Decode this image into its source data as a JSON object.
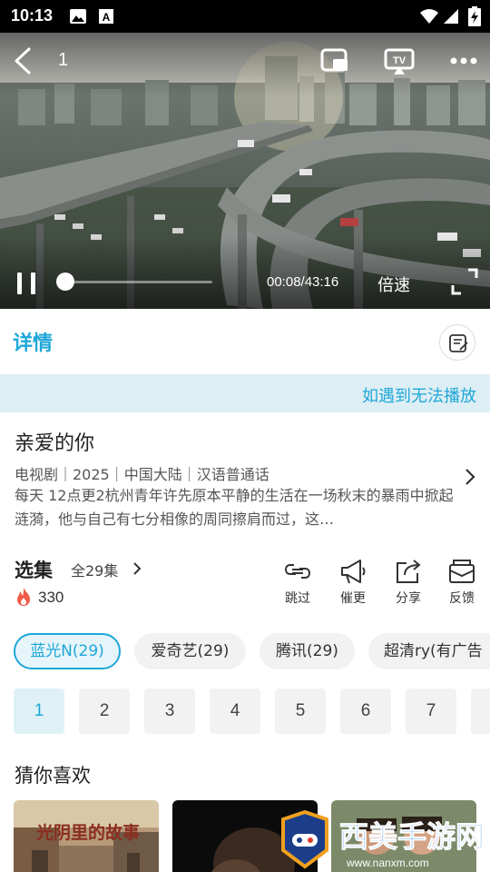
{
  "status_bar": {
    "time": "10:13",
    "icons": [
      "gallery-icon",
      "a-notification-icon",
      "wifi-icon",
      "signal-icon",
      "battery-icon"
    ]
  },
  "player": {
    "episode_label": "1",
    "current_time_total": "00:08/43:16",
    "speed_label": "倍速",
    "progress_fraction": 0.003,
    "icons": [
      "back-icon",
      "pip-icon",
      "tv-cast-icon",
      "more-icon",
      "pause-icon",
      "fullscreen-icon"
    ]
  },
  "detail_tab": {
    "title": "详情",
    "note_icon": "note-icon"
  },
  "notice": {
    "text": "如遇到无法播放"
  },
  "show": {
    "title": "亲爱的你",
    "meta": "电视剧｜2025｜中国大陆｜汉语普通话",
    "description": "每天 12点更2杭州青年许先原本平静的生活在一场秋末的暴雨中掀起涟漪，他与自己有七分相像的周同擦肩而过，这…"
  },
  "episodes": {
    "title": "选集",
    "count": "全29集",
    "hot_count": "330",
    "actions": [
      {
        "label": "跳过",
        "icon": "skip-icon"
      },
      {
        "label": "催更",
        "icon": "megaphone-icon"
      },
      {
        "label": "分享",
        "icon": "share-icon"
      },
      {
        "label": "反馈",
        "icon": "feedback-icon"
      }
    ],
    "sources": [
      "蓝光N(29)",
      "爱奇艺(29)",
      "腾讯(29)",
      "超清ry(有广告"
    ],
    "active_source": "蓝光N(29)",
    "numbers": [
      "1",
      "2",
      "3",
      "4",
      "5",
      "6",
      "7"
    ],
    "active_episode": "1"
  },
  "recommend": {
    "title": "猜你喜欢",
    "poster1_text": "光阴里的故事"
  },
  "watermark": {
    "brand": "西美手游网",
    "url": "www.nanxm.com"
  },
  "colors": {
    "accent": "#1ea7d8",
    "notice_bg": "#ddeef4",
    "chip_bg": "#f2f2f2"
  }
}
